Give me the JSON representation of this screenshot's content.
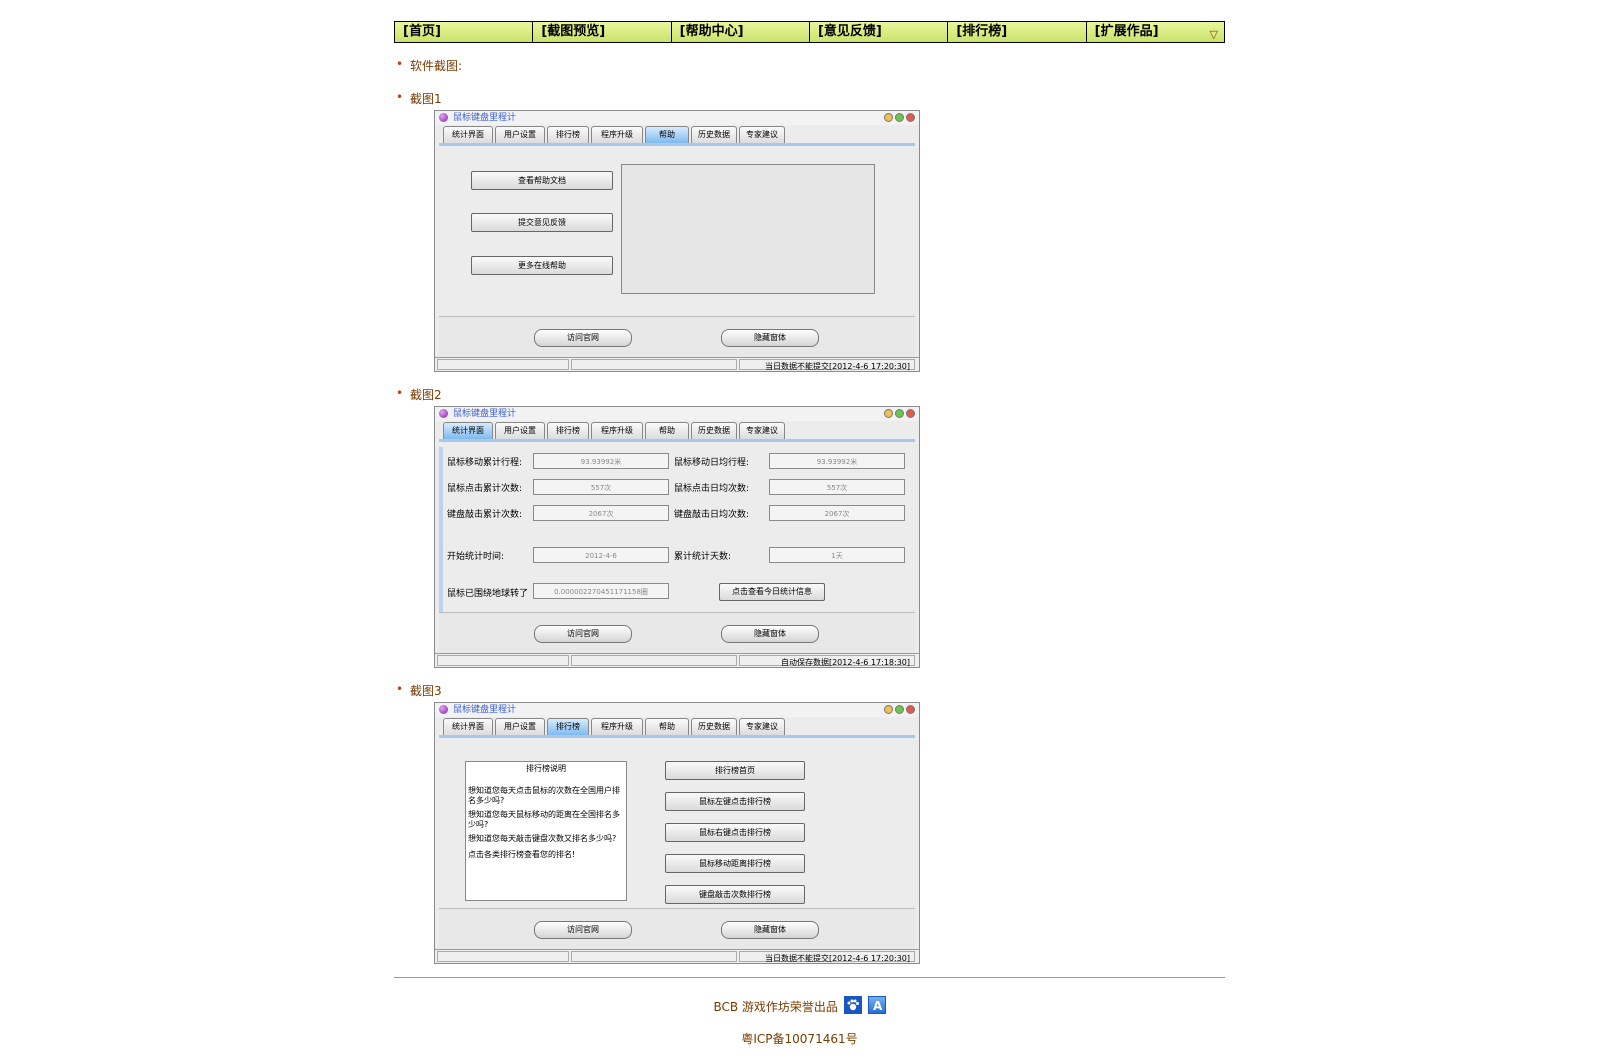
{
  "nav": {
    "items": [
      "[首页]",
      "[截图预览]",
      "[帮助中心]",
      "[意见反馈]",
      "[排行榜]",
      "[扩展作品]"
    ],
    "dropdown_icon": "triangle-down-icon"
  },
  "sections": {
    "intro": "软件截图:",
    "shot1": "截图1",
    "shot2": "截图2",
    "shot3": "截图3"
  },
  "app": {
    "title": "鼠标键盘里程计",
    "tabs": [
      "统计界面",
      "用户设置",
      "排行榜",
      "程序升级",
      "帮助",
      "历史数据",
      "专家建议"
    ],
    "visit_site": "访问官网",
    "hide_window": "隐藏窗体"
  },
  "shot1": {
    "active_tab": "帮助",
    "help_doc": "查看帮助文档",
    "submit_feedback": "提交意见反馈",
    "more_help": "更多在线帮助",
    "status": "当日数据不能提交[2012-4-6 17:20:30]"
  },
  "shot2": {
    "active_tab": "统计界面",
    "rows": [
      {
        "l1": "鼠标移动累计行程:",
        "v1": "93.93992米",
        "l2": "鼠标移动日均行程:",
        "v2": "93.93992米"
      },
      {
        "l1": "鼠标点击累计次数:",
        "v1": "557次",
        "l2": "鼠标点击日均次数:",
        "v2": "557次"
      },
      {
        "l1": "键盘敲击累计次数:",
        "v1": "2067次",
        "l2": "键盘敲击日均次数:",
        "v2": "2067次"
      }
    ],
    "start_label": "开始统计时间:",
    "start_value": "2012-4-6",
    "days_label": "累计统计天数:",
    "days_value": "1天",
    "orbit_label": "鼠标已围绕地球转了",
    "orbit_value": "0.000002270451171158圈",
    "today_btn": "点击查看今日统计信息",
    "status": "自动保存数据[2012-4-6 17:18:30]"
  },
  "shot3": {
    "active_tab": "排行榜",
    "rank_title": "排行榜说明",
    "rank_lines": [
      "想知道您每天点击鼠标的次数在全国用户排名多少吗?",
      "想知道您每天鼠标移动的距离在全国排名多少吗?",
      "想知道您每天敲击键盘次数又排名多少吗?",
      "点击各类排行榜查看您的排名!"
    ],
    "buttons": [
      "排行榜首页",
      "鼠标左键点击排行榜",
      "鼠标右键点击排行榜",
      "鼠标移动距离排行榜",
      "键盘敲击次数排行榜"
    ],
    "status": "当日数据不能提交[2012-4-6 17:20:30]"
  },
  "footer": {
    "credit": "BCB 游戏作坊荣誉出品",
    "icons": [
      "baidu-paw-icon",
      "app-a-icon"
    ],
    "icp": "粤ICP备10071461号"
  },
  "colors": {
    "nav_bg": "#c9e36b",
    "link_brown": "#7a3b00",
    "tab_active": "#7fb9ee",
    "title_blue": "#3b5ed8"
  }
}
